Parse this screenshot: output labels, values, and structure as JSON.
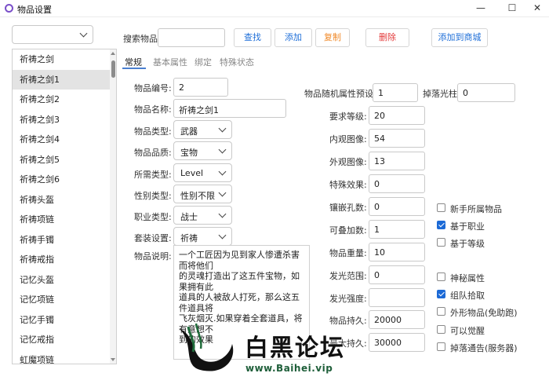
{
  "window": {
    "title": "物品设置",
    "minimize": "—",
    "maximize": "☐",
    "close": "✕"
  },
  "top_select": {
    "value": ""
  },
  "search": {
    "label": "搜索物品",
    "value": ""
  },
  "toolbar": {
    "find": {
      "label": "查找",
      "color": "#1f6fd8"
    },
    "add": {
      "label": "添加",
      "color": "#1f6fd8"
    },
    "copy": {
      "label": "复制",
      "color": "#f08a2a"
    },
    "delete": {
      "label": "删除",
      "color": "#e33b3b"
    },
    "add_to_shop": {
      "label": "添加到商城",
      "color": "#1f6fd8"
    }
  },
  "item_list": {
    "items": [
      "祈祷之剑",
      "祈祷之剑1",
      "祈祷之剑2",
      "祈祷之剑3",
      "祈祷之剑4",
      "祈祷之剑5",
      "祈祷之剑6",
      "祈祷头盔",
      "祈祷项链",
      "祈祷手镯",
      "祈祷戒指",
      "记忆头盔",
      "记忆项链",
      "记忆手镯",
      "记忆戒指",
      "虹魔项链"
    ],
    "selected_index": 1
  },
  "tabs": [
    "常规",
    "基本属性",
    "绑定",
    "特殊状态"
  ],
  "active_tab": 0,
  "form_left": {
    "item_id": {
      "label": "物品编号:",
      "value": "2"
    },
    "item_name": {
      "label": "物品名称:",
      "value": "祈祷之剑1"
    },
    "item_type": {
      "label": "物品类型:",
      "value": "武器"
    },
    "item_quality": {
      "label": "物品品质:",
      "value": "宝物"
    },
    "req_type": {
      "label": "所需类型:",
      "value": "Level"
    },
    "gender_type": {
      "label": "性别类型:",
      "value": "性别不限"
    },
    "job_type": {
      "label": "职业类型:",
      "value": "战士"
    },
    "set_setting": {
      "label": "套装设置:",
      "value": "祈祷"
    },
    "description": {
      "label": "物品说明:",
      "value": "一个工匠因为见到家人惨遭杀害而将他们\n的灵魂打造出了这五件宝物，如果拥有此\n道具的人被敌人打死，那么这五件道具将\n飞灰烟灭.如果穿着全套道具，将有意想不\n到的效果"
    }
  },
  "form_mid": {
    "random_preset": {
      "label": "物品随机属性预设:",
      "value": "1"
    },
    "req_level": {
      "label": "要求等级:",
      "value": "20"
    },
    "inner_image": {
      "label": "内观图像:",
      "value": "54"
    },
    "outer_image": {
      "label": "外观图像:",
      "value": "13"
    },
    "special_effect": {
      "label": "特殊效果:",
      "value": "0"
    },
    "socket_count": {
      "label": "镶嵌孔数:",
      "value": "0"
    },
    "stack_count": {
      "label": "可叠加数:",
      "value": "1"
    },
    "item_weight": {
      "label": "物品重量:",
      "value": "10"
    },
    "glow_range": {
      "label": "发光范围:",
      "value": "0"
    },
    "glow_strength": {
      "label": "发光强度:",
      "value": ""
    },
    "durability": {
      "label": "物品持久:",
      "value": "20000"
    },
    "max_durability": {
      "label": "最大持久:",
      "value": "30000"
    }
  },
  "drop_beam": {
    "label": "掉落光柱:",
    "value": "0"
  },
  "checkboxes": [
    {
      "label": "新手所属物品",
      "checked": false
    },
    {
      "label": "基于职业",
      "checked": true
    },
    {
      "label": "基于等级",
      "checked": false
    },
    {
      "label": "神秘属性",
      "checked": false
    },
    {
      "label": "组队拾取",
      "checked": true
    },
    {
      "label": "外形物品(免助跑)",
      "checked": false
    },
    {
      "label": "可以觉醒",
      "checked": false
    },
    {
      "label": "掉落通告(服务器)",
      "checked": false
    }
  ],
  "watermark": {
    "title": "白黑论坛",
    "url": "www.Baihei.vip"
  }
}
